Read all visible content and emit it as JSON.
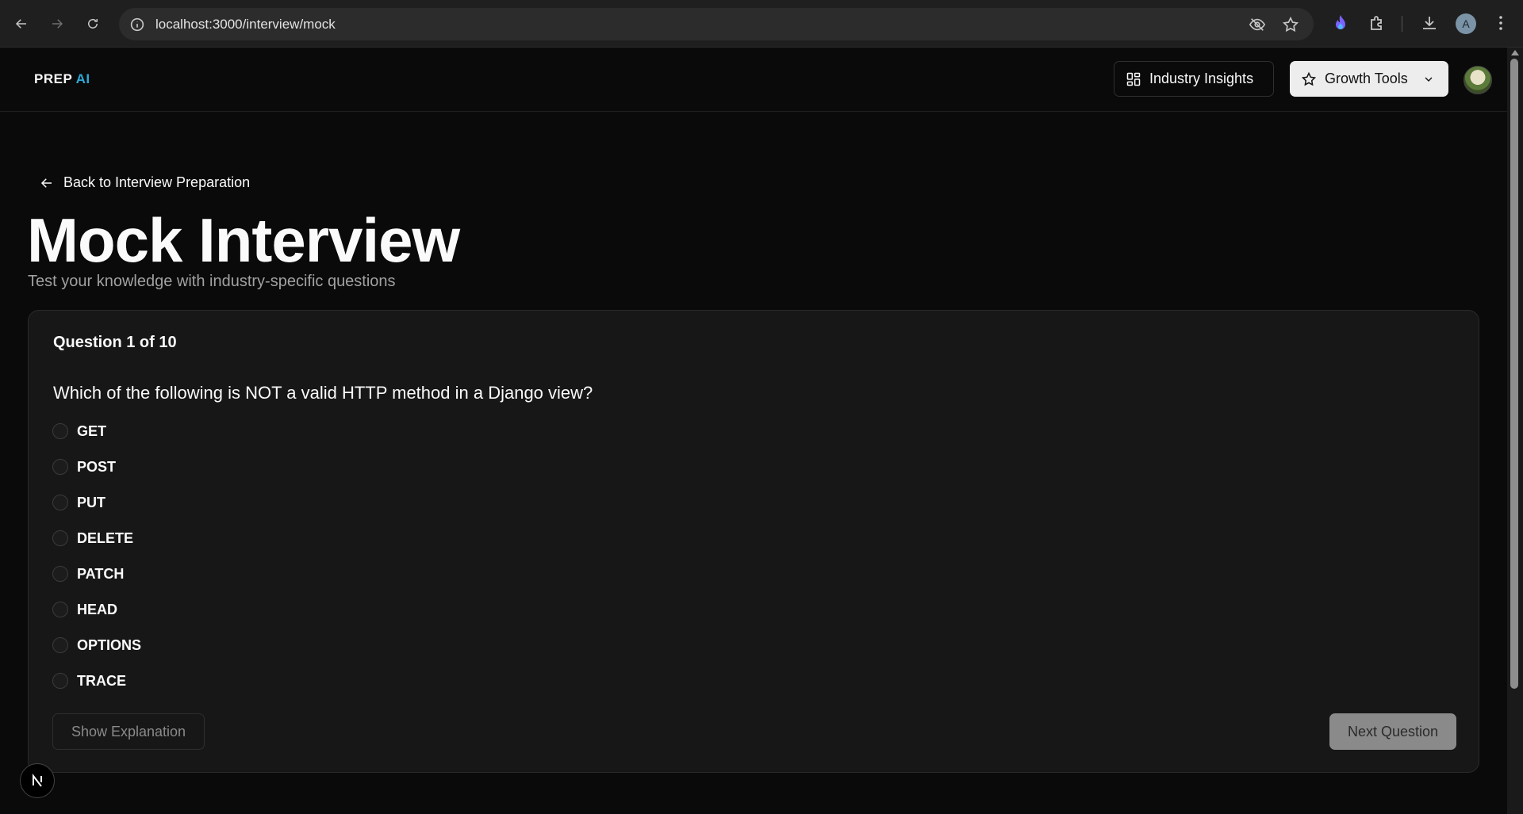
{
  "browser": {
    "url": "localhost:3000/interview/mock",
    "profile_initial": "A"
  },
  "header": {
    "logo_main": "PREP",
    "logo_accent": "AI",
    "insights_label": "Industry Insights",
    "growth_label": "Growth Tools"
  },
  "main": {
    "back_label": "Back to Interview Preparation",
    "title": "Mock Interview",
    "subtitle": "Test your knowledge with industry-specific questions"
  },
  "quiz": {
    "counter": "Question 1 of 10",
    "question": "Which of the following is NOT a valid HTTP method in a Django view?",
    "options": [
      "GET",
      "POST",
      "PUT",
      "DELETE",
      "PATCH",
      "HEAD",
      "OPTIONS",
      "TRACE"
    ],
    "explain_label": "Show Explanation",
    "next_label": "Next Question"
  },
  "badge": {
    "letter": "N"
  }
}
